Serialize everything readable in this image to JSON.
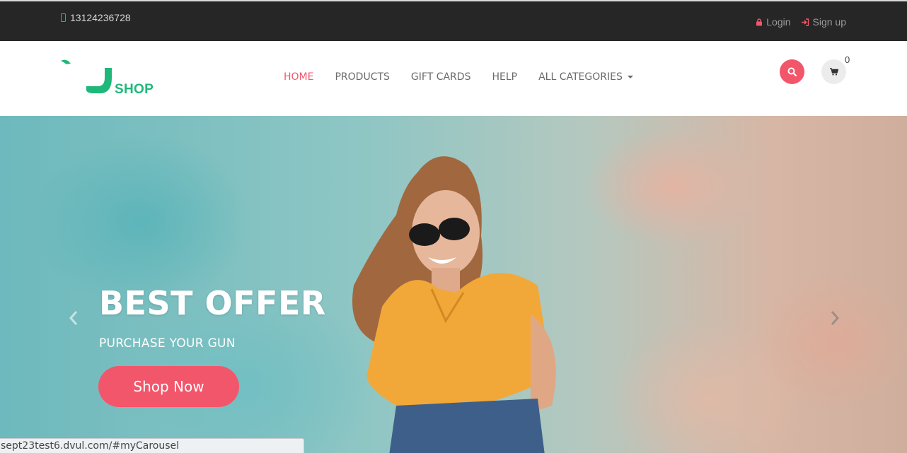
{
  "topbar": {
    "phone": "13124236728",
    "login_label": "Login",
    "signup_label": "Sign up"
  },
  "header": {
    "logo_text": "SHOP",
    "nav": [
      {
        "label": "HOME",
        "active": true
      },
      {
        "label": "PRODUCTS"
      },
      {
        "label": "GIFT CARDS"
      },
      {
        "label": "HELP"
      },
      {
        "label": "ALL CATEGORIES"
      }
    ],
    "cart_count": "0"
  },
  "hero": {
    "title": "BEST OFFER",
    "subtitle": "PURCHASE YOUR GUN",
    "cta_label": "Shop Now"
  },
  "status_bar": {
    "url": "sept23test6.dvul.com/#myCarousel"
  },
  "colors": {
    "accent": "#f2566b",
    "brand_green": "#1fb87a",
    "topbar_bg": "#262626"
  },
  "icons": [
    "phone-icon",
    "lock-icon",
    "sign-in-icon",
    "search-icon",
    "cart-icon",
    "chevron-left-icon",
    "chevron-right-icon",
    "caret-down-icon"
  ]
}
